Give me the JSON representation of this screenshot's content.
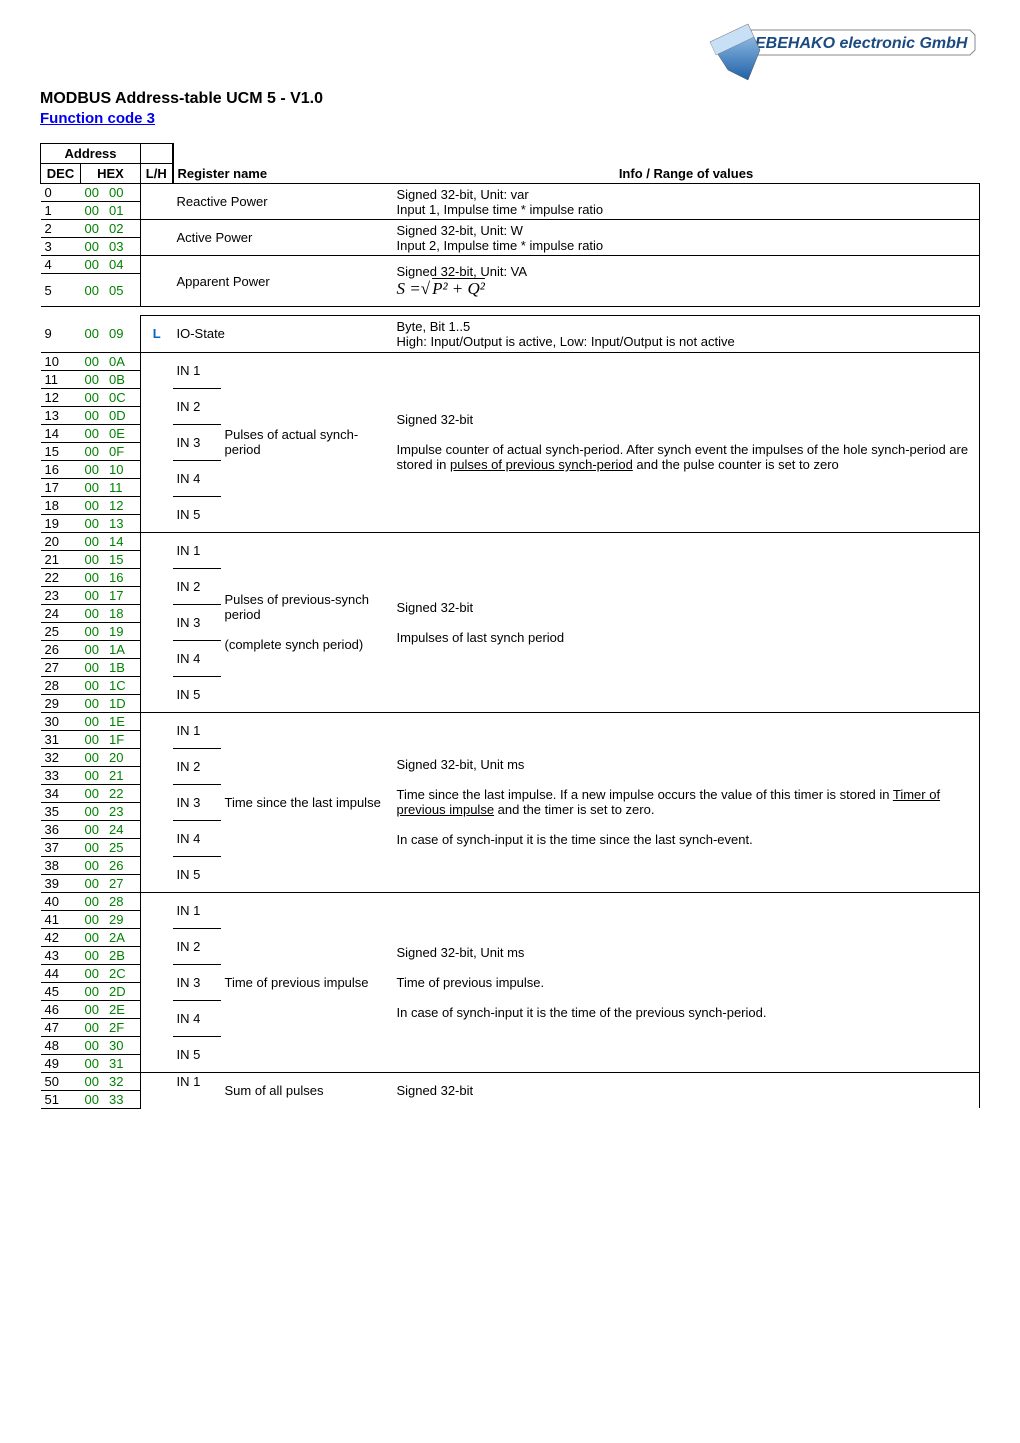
{
  "logo": {
    "text": "EBEHAKO electronic GmbH"
  },
  "title": "MODBUS Address-table UCM 5 - V1.0",
  "subtitle": "Function code 3",
  "hdr": {
    "address": "Address",
    "dec": "DEC",
    "hex": "HEX",
    "lh": "L/H",
    "regname": "Register name",
    "info_label": "Info",
    "info_suffix": " / Range of values"
  },
  "rows": [
    {
      "dec": "0",
      "hex1": "00",
      "hex2": "00"
    },
    {
      "dec": "1",
      "hex1": "00",
      "hex2": "01"
    },
    {
      "dec": "2",
      "hex1": "00",
      "hex2": "02"
    },
    {
      "dec": "3",
      "hex1": "00",
      "hex2": "03"
    },
    {
      "dec": "4",
      "hex1": "00",
      "hex2": "04"
    },
    {
      "dec": "5",
      "hex1": "00",
      "hex2": "05"
    },
    {
      "dec": "9",
      "hex1": "00",
      "hex2": "09"
    },
    {
      "dec": "10",
      "hex1": "00",
      "hex2": "0A"
    },
    {
      "dec": "11",
      "hex1": "00",
      "hex2": "0B"
    },
    {
      "dec": "12",
      "hex1": "00",
      "hex2": "0C"
    },
    {
      "dec": "13",
      "hex1": "00",
      "hex2": "0D"
    },
    {
      "dec": "14",
      "hex1": "00",
      "hex2": "0E"
    },
    {
      "dec": "15",
      "hex1": "00",
      "hex2": "0F"
    },
    {
      "dec": "16",
      "hex1": "00",
      "hex2": "10"
    },
    {
      "dec": "17",
      "hex1": "00",
      "hex2": "11"
    },
    {
      "dec": "18",
      "hex1": "00",
      "hex2": "12"
    },
    {
      "dec": "19",
      "hex1": "00",
      "hex2": "13"
    },
    {
      "dec": "20",
      "hex1": "00",
      "hex2": "14"
    },
    {
      "dec": "21",
      "hex1": "00",
      "hex2": "15"
    },
    {
      "dec": "22",
      "hex1": "00",
      "hex2": "16"
    },
    {
      "dec": "23",
      "hex1": "00",
      "hex2": "17"
    },
    {
      "dec": "24",
      "hex1": "00",
      "hex2": "18"
    },
    {
      "dec": "25",
      "hex1": "00",
      "hex2": "19"
    },
    {
      "dec": "26",
      "hex1": "00",
      "hex2": "1A"
    },
    {
      "dec": "27",
      "hex1": "00",
      "hex2": "1B"
    },
    {
      "dec": "28",
      "hex1": "00",
      "hex2": "1C"
    },
    {
      "dec": "29",
      "hex1": "00",
      "hex2": "1D"
    },
    {
      "dec": "30",
      "hex1": "00",
      "hex2": "1E"
    },
    {
      "dec": "31",
      "hex1": "00",
      "hex2": "1F"
    },
    {
      "dec": "32",
      "hex1": "00",
      "hex2": "20"
    },
    {
      "dec": "33",
      "hex1": "00",
      "hex2": "21"
    },
    {
      "dec": "34",
      "hex1": "00",
      "hex2": "22"
    },
    {
      "dec": "35",
      "hex1": "00",
      "hex2": "23"
    },
    {
      "dec": "36",
      "hex1": "00",
      "hex2": "24"
    },
    {
      "dec": "37",
      "hex1": "00",
      "hex2": "25"
    },
    {
      "dec": "38",
      "hex1": "00",
      "hex2": "26"
    },
    {
      "dec": "39",
      "hex1": "00",
      "hex2": "27"
    },
    {
      "dec": "40",
      "hex1": "00",
      "hex2": "28"
    },
    {
      "dec": "41",
      "hex1": "00",
      "hex2": "29"
    },
    {
      "dec": "42",
      "hex1": "00",
      "hex2": "2A"
    },
    {
      "dec": "43",
      "hex1": "00",
      "hex2": "2B"
    },
    {
      "dec": "44",
      "hex1": "00",
      "hex2": "2C"
    },
    {
      "dec": "45",
      "hex1": "00",
      "hex2": "2D"
    },
    {
      "dec": "46",
      "hex1": "00",
      "hex2": "2E"
    },
    {
      "dec": "47",
      "hex1": "00",
      "hex2": "2F"
    },
    {
      "dec": "48",
      "hex1": "00",
      "hex2": "30"
    },
    {
      "dec": "49",
      "hex1": "00",
      "hex2": "31"
    },
    {
      "dec": "50",
      "hex1": "00",
      "hex2": "32"
    },
    {
      "dec": "51",
      "hex1": "00",
      "hex2": "33"
    }
  ],
  "reg": {
    "reactive_power": "Reactive Power",
    "active_power": "Active Power",
    "apparent_power": "Apparent Power",
    "io_state": "IO-State",
    "in1": "IN 1",
    "in2": "IN 2",
    "in3": "IN 3",
    "in4": "IN 4",
    "in5": "IN 5",
    "pulses_actual": "Pulses of actual synch-period",
    "pulses_prev": "Pulses of previous-synch period",
    "complete_synch": "(complete synch period)",
    "time_since_last": "Time since the last impulse",
    "time_of_prev": "Time of previous impulse",
    "sum_all": "Sum of all pulses"
  },
  "info": {
    "reactive": "Signed 32-bit, Unit: var\nInput 1, Impulse time * impulse ratio",
    "active": "Signed 32-bit, Unit: W\nInput 2, Impulse time * impulse ratio",
    "apparent_l1": "Signed 32-bit, Unit: VA",
    "apparent_formula_lhs": "S =",
    "apparent_formula_rhs": "P² + Q²",
    "iostate": "Byte, Bit 1..5\nHigh: Input/Output is active, Low: Input/Output is not active",
    "pulses_actual_l1": "Signed 32-bit",
    "pulses_actual_l2a": "Impulse counter of actual synch-period. After synch event the impulses of the hole synch-period are stored in ",
    "pulses_actual_l2b": "pulses of previous synch-period",
    "pulses_actual_l2c": " and the pulse counter is set to zero",
    "pulses_prev_l1": "Signed 32-bit",
    "pulses_prev_l2": "Impulses of last synch period",
    "time_since_l1": "Signed 32-bit, Unit ms",
    "time_since_l2a": "Time since the last impulse. If a new impulse occurs the value of this timer is stored in ",
    "time_since_l2b": "Timer of previous impulse",
    "time_since_l2c": " and the timer is set to zero.",
    "time_since_l3": "In case of synch-input it is the time since the last synch-event.",
    "time_prev_l1": "Signed 32-bit, Unit ms",
    "time_prev_l2": "Time of previous impulse.",
    "time_prev_l3": "In case of synch-input it is the time of the previous synch-period.",
    "sum_all": "Signed 32-bit"
  },
  "lh": {
    "L": "L"
  }
}
